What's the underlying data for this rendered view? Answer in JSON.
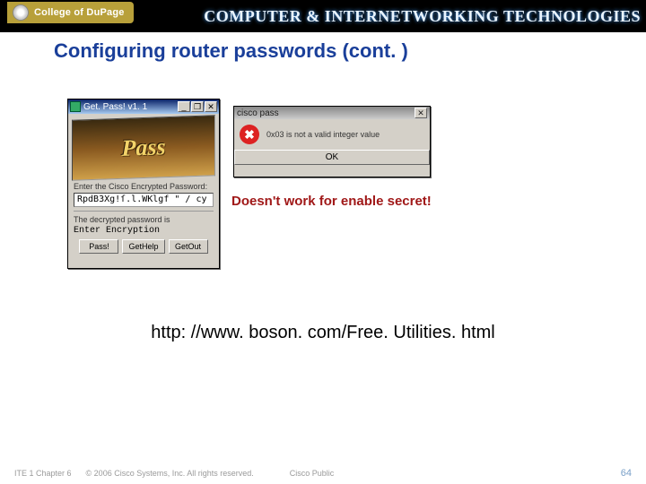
{
  "header": {
    "college_label": "College of DuPage",
    "banner": "COMPUTER & INTERNETWORKING TECHNOLOGIES"
  },
  "slide": {
    "title": "Configuring router passwords (cont. )",
    "callout": "Doesn't work for enable secret!",
    "url": "http: //www. boson. com/Free. Utilities. html"
  },
  "getpass_window": {
    "title": "Get. Pass! v1. 1",
    "minimize": "_",
    "restore": "❐",
    "close": "✕",
    "logo_text": "Pass",
    "input_label": "Enter the Cisco Encrypted Password:",
    "input_value": "RpdB3Xg!ſ.l.WKlgf \" / cy",
    "decrypted_label": "The decrypted password is",
    "decrypted_value": "Enter Encryption",
    "buttons": {
      "decrypt": "Pass!",
      "help": "GetHelp",
      "exit": "GetOut"
    }
  },
  "cisco_dialog": {
    "title": "cisco pass",
    "close": "✕",
    "error_glyph": "✖",
    "error_text": "0x03 is not a valid integer value",
    "ok_label": "OK"
  },
  "footer": {
    "chapter": "ITE 1 Chapter 6",
    "copyright": "© 2006 Cisco Systems, Inc. All rights reserved.",
    "classification": "Cisco Public",
    "page_number": "64"
  }
}
